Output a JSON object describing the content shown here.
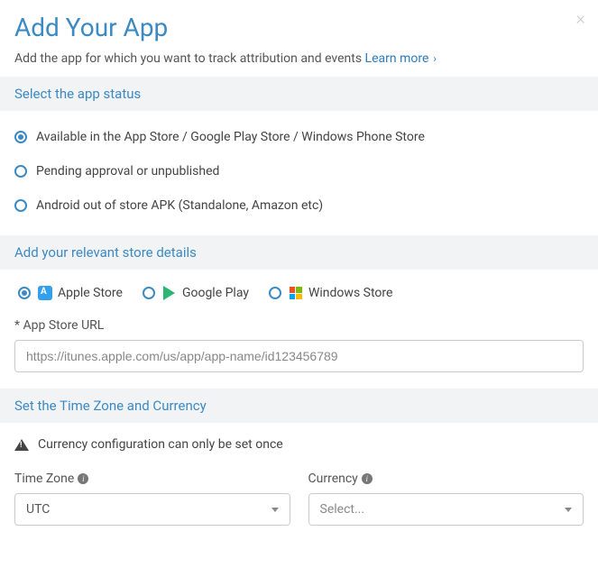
{
  "header": {
    "title": "Add Your App",
    "subtitle": "Add the app for which you want to track attribution and events ",
    "learn_more": "Learn more"
  },
  "sections": {
    "status_title": "Select the app status",
    "store_title": "Add your relevant store details",
    "tz_title": "Set the Time Zone and Currency"
  },
  "status_options": [
    "Available in the App Store / Google Play Store / Windows Phone Store",
    "Pending approval or unpublished",
    "Android out of store APK (Standalone, Amazon etc)"
  ],
  "store_options": {
    "apple": "Apple Store",
    "google": "Google Play",
    "windows": "Windows Store"
  },
  "url_field": {
    "label": "* App Store URL",
    "placeholder": "https://itunes.apple.com/us/app/app-name/id123456789"
  },
  "warning": "Currency configuration can only be set once",
  "tz": {
    "label": "Time Zone",
    "value": "UTC"
  },
  "currency": {
    "label": "Currency",
    "value": "Select..."
  }
}
